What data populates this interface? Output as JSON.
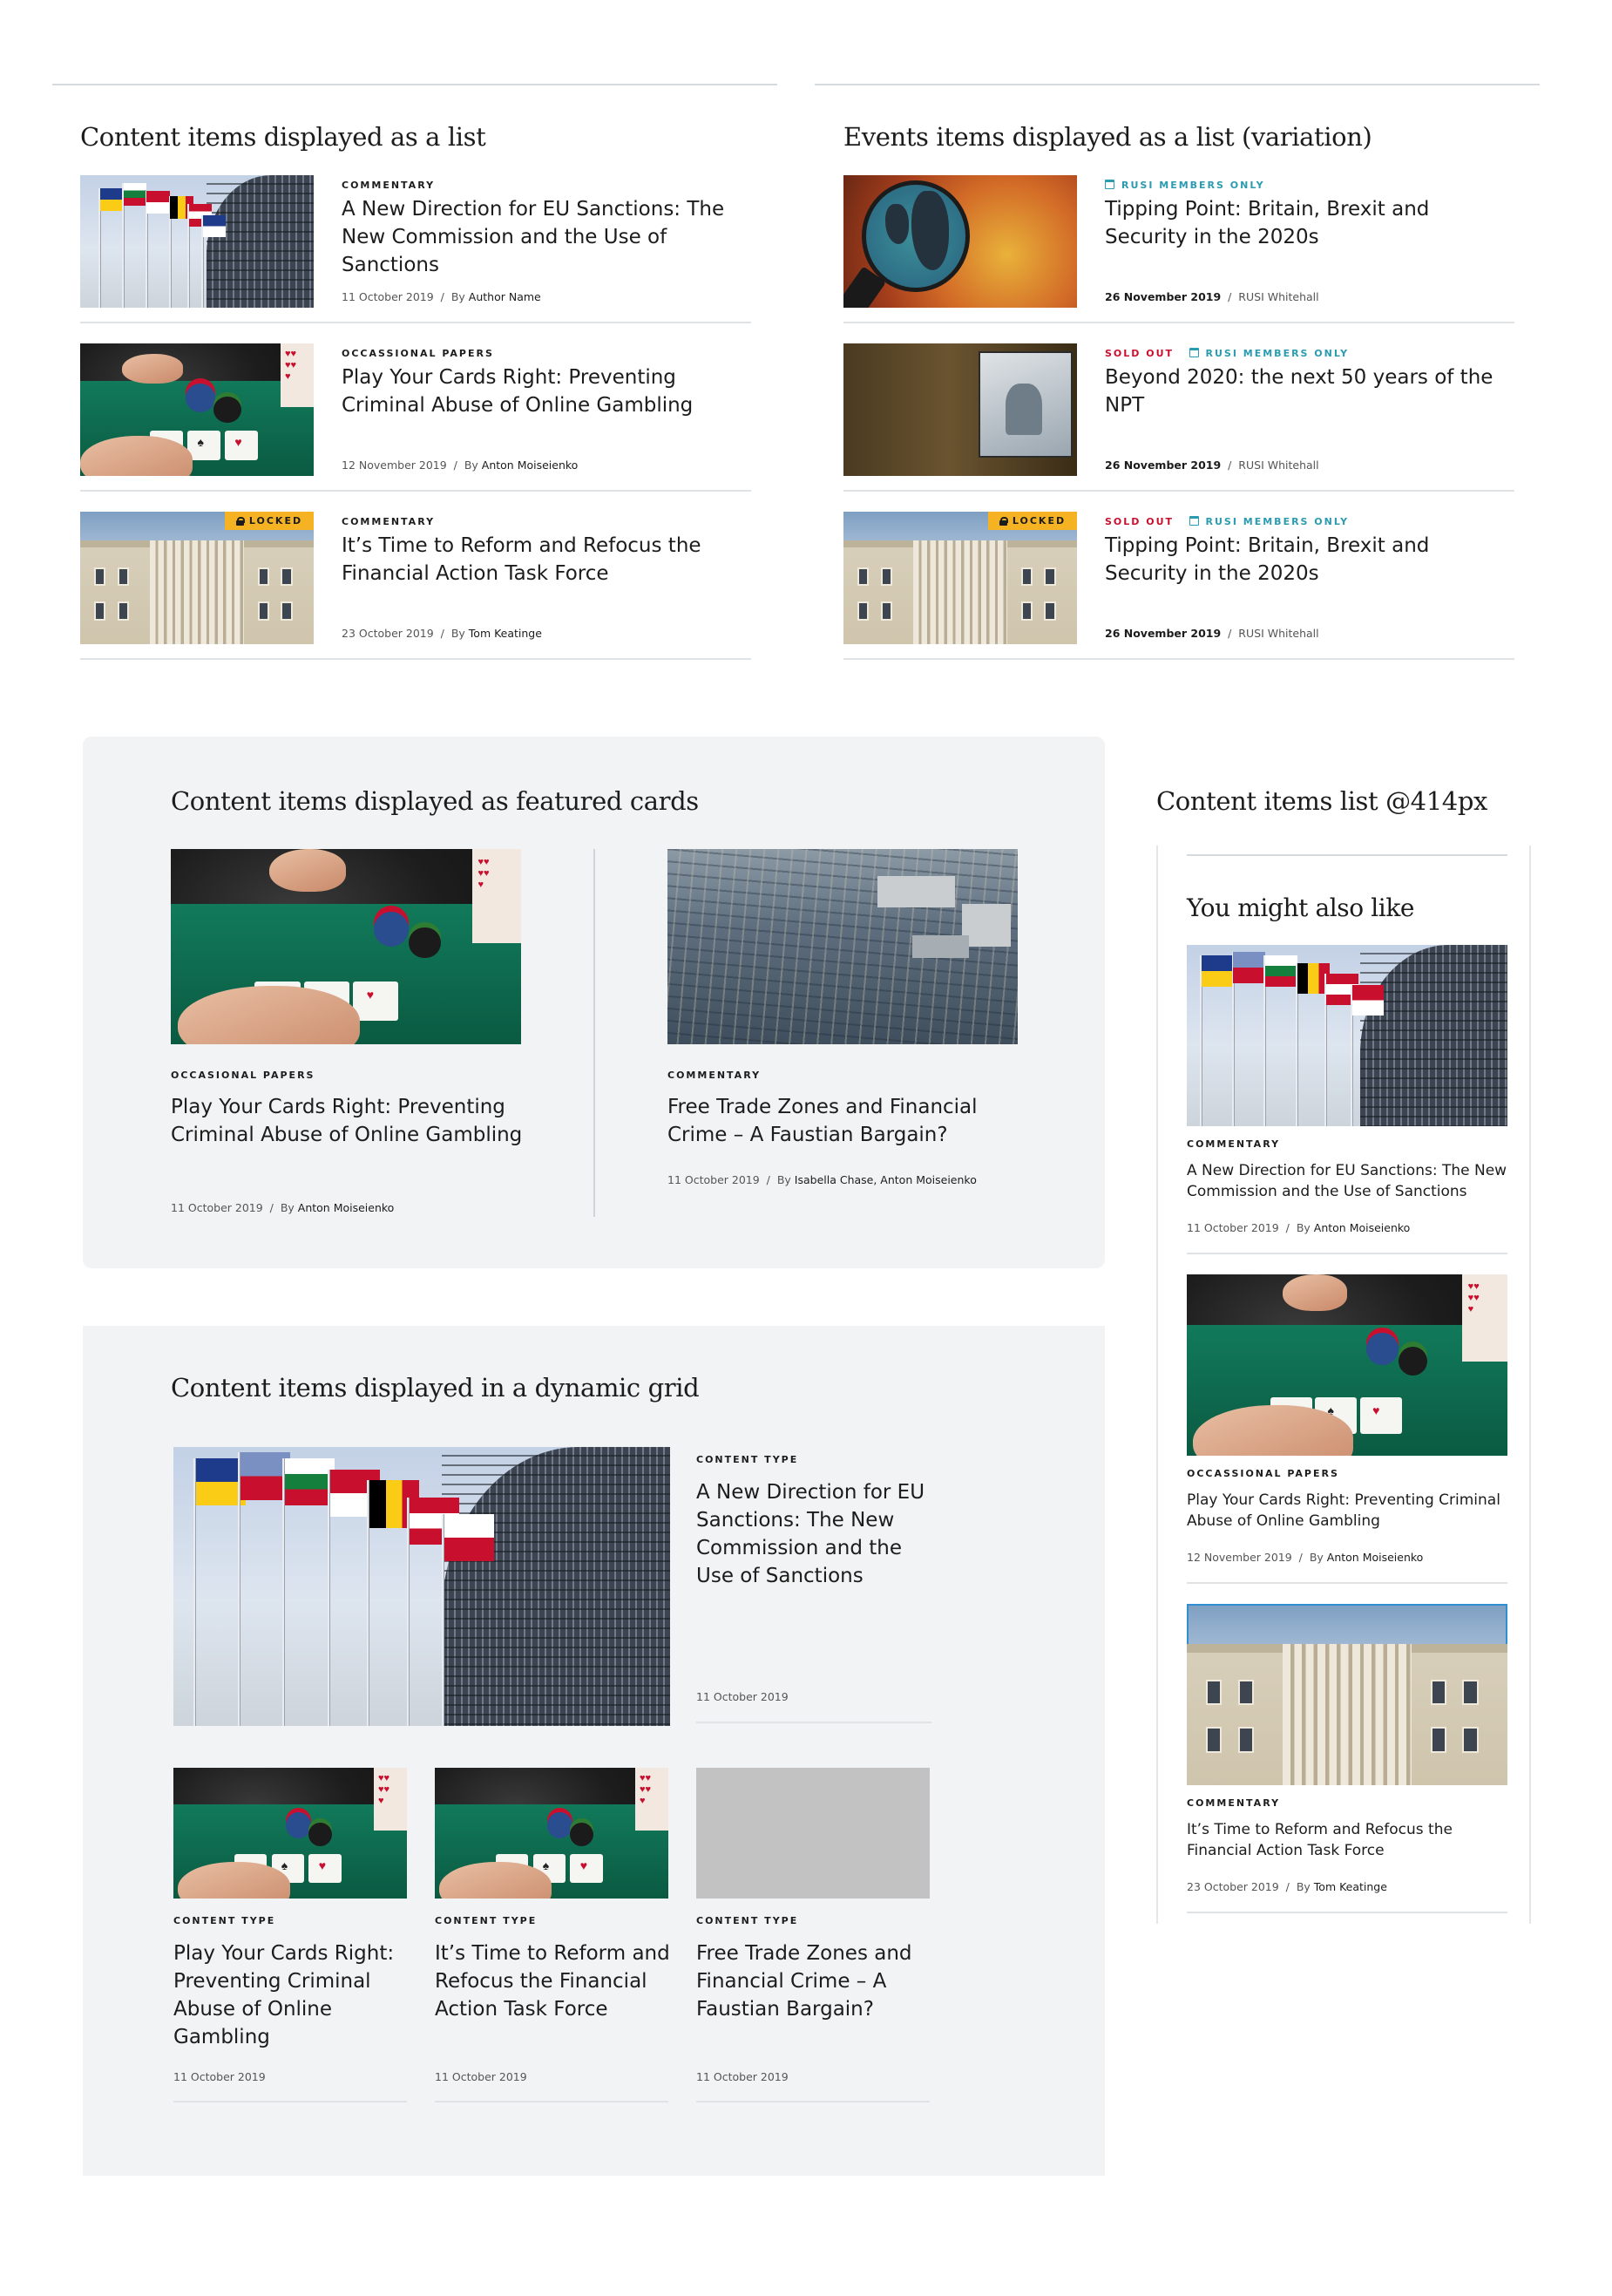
{
  "sections": {
    "list": {
      "title": "Content items displayed as a list"
    },
    "events": {
      "title": "Events items displayed as a list (variation)"
    },
    "featured": {
      "title": "Content items displayed as featured cards"
    },
    "grid": {
      "title": "Content items displayed in a dynamic grid"
    },
    "mobile": {
      "title": "Content items list @414px",
      "subtitle": "You might also like"
    }
  },
  "content_list": [
    {
      "type": "COMMENTARY",
      "title": "A New Direction for EU Sanctions: The New Commission and the Use of Sanctions",
      "date": "11 October 2019",
      "by": "By",
      "author": "Author Name",
      "locked": false
    },
    {
      "type": "OCCASSIONAL PAPERS",
      "title": "Play Your Cards Right: Preventing Criminal Abuse of Online Gambling",
      "date": "12 November 2019",
      "by": "By",
      "author": "Anton Moiseienko",
      "locked": false
    },
    {
      "type": "COMMENTARY",
      "title": "It’s Time to Reform and Refocus the Financial Action Task Force",
      "date": "23 October 2019",
      "by": "By",
      "author": "Tom Keatinge",
      "locked": true,
      "lock_label": "LOCKED"
    }
  ],
  "events_list": [
    {
      "sold_out": "",
      "members": "RUSI MEMBERS ONLY",
      "title": "Tipping Point: Britain, Brexit and Security in the 2020s",
      "date": "26 November 2019",
      "location": "RUSI Whitehall",
      "locked": false
    },
    {
      "sold_out": "SOLD OUT",
      "members": "RUSI MEMBERS ONLY",
      "title": "Beyond 2020: the next 50 years of the NPT",
      "date": "26 November 2019",
      "location": "RUSI Whitehall",
      "locked": false
    },
    {
      "sold_out": "SOLD OUT",
      "members": "RUSI MEMBERS ONLY",
      "title": "Tipping Point: Britain, Brexit and Security in the 2020s",
      "date": "26 November 2019",
      "location": "RUSI Whitehall",
      "locked": true,
      "lock_label": "LOCKED"
    }
  ],
  "featured_cards": [
    {
      "type": "OCCASIONAL PAPERS",
      "title": "Play Your Cards Right: Preventing Criminal Abuse of Online Gambling",
      "date": "11 October 2019",
      "by": "By",
      "author": "Anton Moiseienko"
    },
    {
      "type": "COMMENTARY",
      "title": "Free Trade Zones and Financial Crime – A Faustian Bargain?",
      "date": "11 October 2019",
      "by": "By",
      "author": "Isabella Chase, Anton Moiseienko"
    }
  ],
  "grid": {
    "hero": {
      "type": "CONTENT TYPE",
      "title": "A New Direction for EU Sanctions: The New Commission and the Use of Sanctions",
      "date": "11 October 2019"
    },
    "items": [
      {
        "type": "CONTENT TYPE",
        "title": "Play Your Cards Right: Preventing Criminal Abuse of Online Gambling",
        "date": "11 October 2019"
      },
      {
        "type": "CONTENT TYPE",
        "title": "It’s Time to Reform and Refocus the Financial Action Task Force",
        "date": "11 October 2019"
      },
      {
        "type": "CONTENT TYPE",
        "title": "Free Trade Zones and Financial Crime – A Faustian Bargain?",
        "date": "11 October 2019"
      }
    ]
  },
  "mobile_list": [
    {
      "type": "COMMENTARY",
      "title": "A New Direction for EU Sanctions: The New Commission and the Use of Sanctions",
      "date": "11 October 2019",
      "by": "By",
      "author": "Anton Moiseienko"
    },
    {
      "type": "OCCASSIONAL PAPERS",
      "title": "Play Your Cards Right: Preventing Criminal Abuse of Online Gambling",
      "date": "12 November 2019",
      "by": "By",
      "author": "Anton Moiseienko"
    },
    {
      "type": "COMMENTARY",
      "title": "It’s Time to Reform and Refocus the Financial Action Task Force",
      "date": "23 October 2019",
      "by": "By",
      "author": "Tom Keatinge"
    }
  ],
  "colors": {
    "lock_badge": "#f5b324",
    "sold_out": "#c8102e",
    "members_only": "#2a9bb0",
    "panel": "#f2f3f4"
  },
  "icons": {
    "lock": "lock-icon",
    "calendar": "calendar-icon"
  }
}
